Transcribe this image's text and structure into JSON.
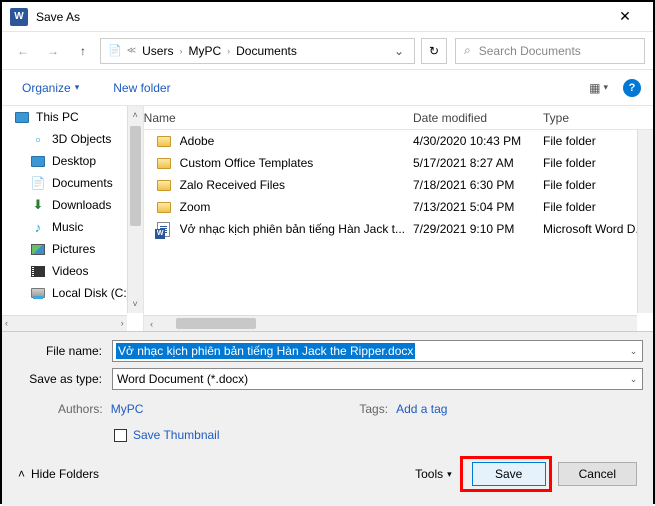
{
  "title": "Save As",
  "breadcrumb": {
    "seg1": "Users",
    "seg2": "MyPC",
    "seg3": "Documents"
  },
  "search": {
    "placeholder": "Search Documents"
  },
  "toolbar": {
    "organize": "Organize",
    "newfolder": "New folder"
  },
  "sidebar": {
    "thispc": "This PC",
    "objects3d": "3D Objects",
    "desktop": "Desktop",
    "documents": "Documents",
    "downloads": "Downloads",
    "music": "Music",
    "pictures": "Pictures",
    "videos": "Videos",
    "localdisk": "Local Disk (C:)"
  },
  "columns": {
    "name": "Name",
    "date": "Date modified",
    "type": "Type"
  },
  "files": [
    {
      "name": "Adobe",
      "date": "4/30/2020 10:43 PM",
      "type": "File folder",
      "kind": "folder"
    },
    {
      "name": "Custom Office Templates",
      "date": "5/17/2021 8:27 AM",
      "type": "File folder",
      "kind": "folder"
    },
    {
      "name": "Zalo Received Files",
      "date": "7/18/2021 6:30 PM",
      "type": "File folder",
      "kind": "folder"
    },
    {
      "name": "Zoom",
      "date": "7/13/2021 5:04 PM",
      "type": "File folder",
      "kind": "folder"
    },
    {
      "name": "Vở nhạc kịch phiên bản tiếng Hàn Jack t...",
      "date": "7/29/2021 9:10 PM",
      "type": "Microsoft Word D...",
      "kind": "doc"
    }
  ],
  "form": {
    "filename_label": "File name:",
    "filename_value": "Vở nhạc kịch phiên bản tiếng Hàn Jack the Ripper.docx",
    "savetype_label": "Save as type:",
    "savetype_value": "Word Document (*.docx)",
    "authors_label": "Authors:",
    "authors_value": "MyPC",
    "tags_label": "Tags:",
    "tags_value": "Add a tag",
    "thumbnail": "Save Thumbnail"
  },
  "footer": {
    "hide": "Hide Folders",
    "tools": "Tools",
    "save": "Save",
    "cancel": "Cancel"
  }
}
